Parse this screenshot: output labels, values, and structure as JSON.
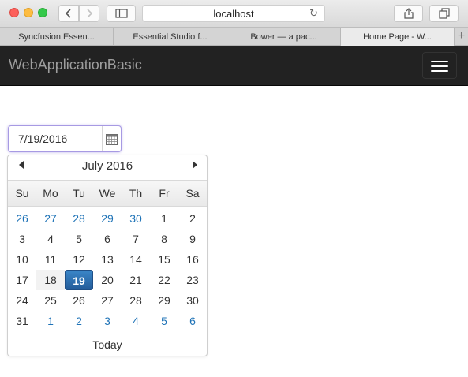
{
  "browser": {
    "address": "localhost",
    "tabs": [
      {
        "label": "Syncfusion Essen...",
        "active": false
      },
      {
        "label": "Essential Studio f...",
        "active": false
      },
      {
        "label": "Bower — a pac...",
        "active": false
      },
      {
        "label": "Home Page - W...",
        "active": true
      }
    ]
  },
  "app": {
    "brand": "WebApplicationBasic"
  },
  "datepicker": {
    "value": "7/19/2016",
    "month_title": "July 2016",
    "weekdays": [
      "Su",
      "Mo",
      "Tu",
      "We",
      "Th",
      "Fr",
      "Sa"
    ],
    "weeks": [
      [
        {
          "d": "26",
          "other": true
        },
        {
          "d": "27",
          "other": true
        },
        {
          "d": "28",
          "other": true
        },
        {
          "d": "29",
          "other": true
        },
        {
          "d": "30",
          "other": true
        },
        {
          "d": "1"
        },
        {
          "d": "2"
        }
      ],
      [
        {
          "d": "3"
        },
        {
          "d": "4"
        },
        {
          "d": "5"
        },
        {
          "d": "6"
        },
        {
          "d": "7"
        },
        {
          "d": "8"
        },
        {
          "d": "9"
        }
      ],
      [
        {
          "d": "10"
        },
        {
          "d": "11"
        },
        {
          "d": "12"
        },
        {
          "d": "13"
        },
        {
          "d": "14"
        },
        {
          "d": "15"
        },
        {
          "d": "16"
        }
      ],
      [
        {
          "d": "17"
        },
        {
          "d": "18",
          "today": true
        },
        {
          "d": "19",
          "selected": true
        },
        {
          "d": "20"
        },
        {
          "d": "21"
        },
        {
          "d": "22"
        },
        {
          "d": "23"
        }
      ],
      [
        {
          "d": "24"
        },
        {
          "d": "25"
        },
        {
          "d": "26"
        },
        {
          "d": "27"
        },
        {
          "d": "28"
        },
        {
          "d": "29"
        },
        {
          "d": "30"
        }
      ],
      [
        {
          "d": "31"
        },
        {
          "d": "1",
          "other": true
        },
        {
          "d": "2",
          "other": true
        },
        {
          "d": "3",
          "other": true
        },
        {
          "d": "4",
          "other": true
        },
        {
          "d": "5",
          "other": true
        },
        {
          "d": "6",
          "other": true
        }
      ]
    ],
    "footer": "Today"
  },
  "colors": {
    "navbar_bg": "#222222",
    "selected_day": "#2c6aa8",
    "other_month_day": "#1f73b7"
  },
  "icons": {
    "back": "chevron-left-icon",
    "forward": "chevron-right-icon",
    "sidebar": "sidebar-icon",
    "reload": "reload-icon",
    "share": "share-icon",
    "tabs": "tabs-icon",
    "add_tab": "plus-icon",
    "menu": "hamburger-icon",
    "calendar": "calendar-icon"
  }
}
